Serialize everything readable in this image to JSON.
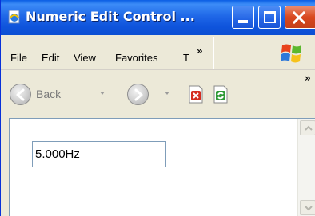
{
  "window": {
    "title": "Numeric Edit Control ..."
  },
  "menubar": {
    "items": [
      "File",
      "Edit",
      "View",
      "Favorites",
      "T"
    ],
    "overflow": "»"
  },
  "toolbar": {
    "back_label": "Back",
    "overflow": "»"
  },
  "content": {
    "numeric_value": "5.000Hz"
  },
  "icons": {
    "app": "ie-page-icon",
    "minimize": "minimize-icon",
    "maximize": "maximize-icon",
    "close": "close-icon",
    "logo": "windows-logo-icon",
    "back": "back-arrow-icon",
    "forward": "forward-arrow-icon",
    "stop": "stop-icon",
    "refresh": "refresh-icon"
  },
  "colors": {
    "titlebar": "#0c4fd3",
    "close_button": "#d9471e",
    "chrome": "#ece9d8",
    "input_border": "#7f9db9"
  }
}
